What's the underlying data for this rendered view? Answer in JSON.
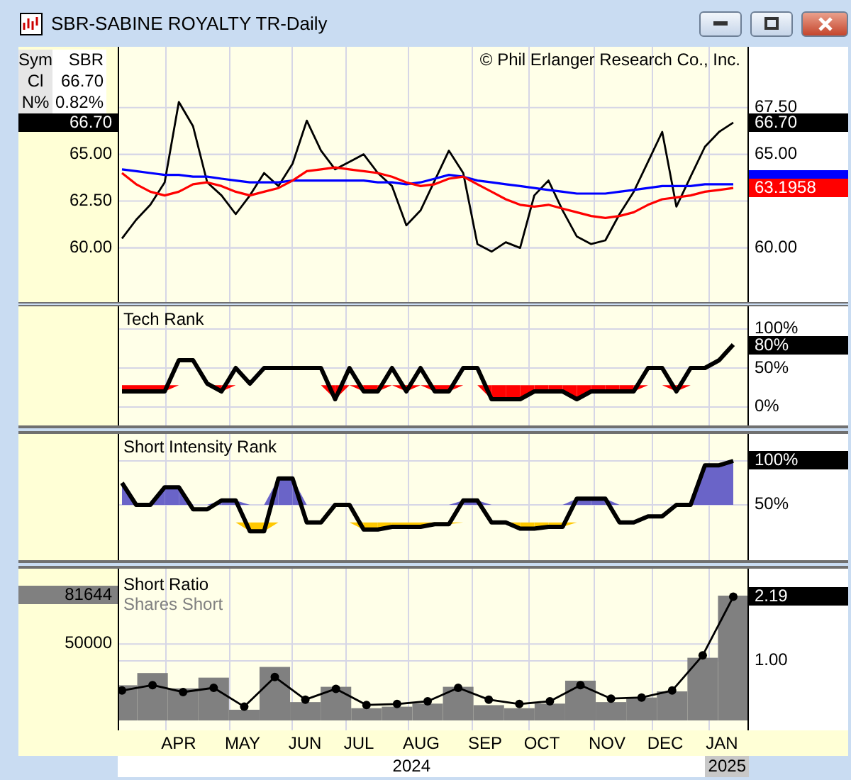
{
  "window": {
    "title": "SBR-SABINE ROYALTY TR-Daily"
  },
  "quote": {
    "rows": [
      {
        "label": "Sym",
        "value": "SBR"
      },
      {
        "label": "Cl",
        "value": "66.70"
      },
      {
        "label": "N%",
        "value": "0.82%"
      }
    ]
  },
  "copyright": "© Phil Erlanger Research Co., Inc.",
  "panels": [
    {
      "kind": "price",
      "left_ticks": [
        "65.00",
        "62.50",
        "60.00"
      ],
      "left_tags": [
        {
          "label": "66.70",
          "color": "#000000"
        }
      ],
      "right_tags": [
        {
          "label": "66.70",
          "color": "#000000"
        },
        {
          "label": "63.1958",
          "color": "#ff0000"
        }
      ],
      "chart_data": {
        "type": "line",
        "grid": true,
        "ylim": [
          57.1,
          70.75
        ],
        "yticks": [
          {
            "value": 67.5,
            "label": "67.50"
          },
          {
            "value": 65,
            "label": "65.00"
          },
          {
            "value": 60,
            "label": "60.00"
          }
        ],
        "series": [
          {
            "color": "#000000",
            "values": [
              60.5,
              61.5,
              62.3,
              63.5,
              67.8,
              66.5,
              63.5,
              62.8,
              61.8,
              62.8,
              64,
              63.3,
              64.5,
              66.8,
              65.2,
              64.2,
              64.6,
              65,
              64,
              63.3,
              61.2,
              62,
              63.6,
              65.2,
              64,
              60.2,
              59.8,
              60.3,
              60,
              62.8,
              63.6,
              62,
              60.6,
              60.2,
              60.4,
              61.8,
              63,
              64.6,
              66.2,
              62.2,
              63.8,
              65.4,
              66.2,
              66.7
            ]
          },
          {
            "color": "#0000ff",
            "values": [
              64.2,
              64.1,
              64,
              63.9,
              63.9,
              63.8,
              63.8,
              63.7,
              63.6,
              63.5,
              63.5,
              63.5,
              63.6,
              63.6,
              63.6,
              63.6,
              63.6,
              63.6,
              63.5,
              63.5,
              63.4,
              63.5,
              63.7,
              63.9,
              63.8,
              63.6,
              63.5,
              63.4,
              63.3,
              63.2,
              63.1,
              63,
              62.9,
              62.9,
              62.9,
              63,
              63.1,
              63.2,
              63.3,
              63.3,
              63.3,
              63.4,
              63.4,
              63.4
            ]
          },
          {
            "color": "#ff0000",
            "values": [
              64,
              63.4,
              63,
              62.8,
              63,
              63.4,
              63.5,
              63.3,
              63,
              62.8,
              63,
              63.2,
              63.6,
              64.1,
              64.2,
              64.3,
              64.2,
              64.1,
              64,
              63.8,
              63.5,
              63.3,
              63.4,
              63.7,
              63.8,
              63.4,
              63,
              62.6,
              62.3,
              62.2,
              62.3,
              62.1,
              61.9,
              61.7,
              61.6,
              61.7,
              61.9,
              62.3,
              62.6,
              62.7,
              62.8,
              63,
              63.1,
              63.2
            ]
          }
        ]
      }
    },
    {
      "kind": "rank_low",
      "right_tags": [
        {
          "label": "80%",
          "color": "#000000"
        }
      ],
      "chart_data": {
        "type": "line",
        "grid": true,
        "title": "Tech Rank",
        "ylim": [
          -23.6,
          129.1
        ],
        "yticks": [
          {
            "value": 100,
            "label": "100%"
          },
          {
            "value": 50,
            "label": "50%"
          },
          {
            "value": 0,
            "label": "0%"
          }
        ],
        "series": [
          {
            "color": "#000000",
            "values": [
              20,
              20,
              20,
              20,
              60,
              60,
              30,
              20,
              50,
              30,
              50,
              50,
              50,
              50,
              50,
              10,
              50,
              20,
              20,
              50,
              20,
              50,
              20,
              20,
              50,
              50,
              10,
              10,
              10,
              20,
              20,
              20,
              10,
              20,
              20,
              20,
              20,
              50,
              50,
              20,
              50,
              50,
              60,
              80
            ]
          }
        ]
      }
    },
    {
      "kind": "rank_split",
      "right_tick_tagged": [
        true,
        false
      ],
      "chart_data": {
        "type": "line",
        "grid": true,
        "title": "Short Intensity Rank",
        "ylim": [
          -12.9,
          130.6
        ],
        "yticks": [
          {
            "value": 100,
            "label": "100%"
          },
          {
            "value": 50,
            "label": "50%"
          }
        ],
        "series": [
          {
            "color": "#000000",
            "values": [
              75,
              50,
              50,
              70,
              70,
              45,
              45,
              55,
              55,
              20,
              20,
              80,
              80,
              30,
              30,
              50,
              50,
              22,
              22,
              25,
              25,
              25,
              28,
              28,
              55,
              55,
              30,
              30,
              23,
              23,
              25,
              25,
              57,
              57,
              57,
              30,
              30,
              37,
              37,
              50,
              50,
              95,
              95,
              100
            ]
          }
        ]
      }
    },
    {
      "kind": "ratio",
      "right_tick_tagged": [
        true,
        false
      ],
      "left_tick_tagged": [
        true,
        false
      ],
      "layers": [
        {
          "chart_data": {
            "type": "line",
            "grid": true,
            "ylim": [
              -0.29,
              2.71
            ],
            "categories": [
              null,
              null,
              null,
              null,
              null,
              null,
              null,
              null,
              null,
              null,
              null,
              null,
              null,
              null,
              null,
              null,
              null,
              null,
              null,
              null,
              null
            ],
            "yticks": [
              {
                "value": 2.19,
                "label": "2.19"
              },
              {
                "value": 1,
                "label": "1.00"
              }
            ],
            "series": [
              {
                "name": "Short Ratio",
                "color": "#000000",
                "marker": "circle",
                "values": [
                  0.45,
                  0.55,
                  0.42,
                  0.5,
                  0.15,
                  0.7,
                  0.28,
                  0.48,
                  0.18,
                  0.2,
                  0.25,
                  0.5,
                  0.28,
                  0.2,
                  0.25,
                  0.55,
                  0.3,
                  0.32,
                  0.45,
                  1.1,
                  2.19
                ]
              }
            ]
          }
        },
        {
          "chart_data": {
            "type": "bar",
            "grid": true,
            "ylim": [
              -6494,
              99263
            ],
            "categories": [
              null,
              null,
              null,
              null,
              null,
              null,
              null,
              null,
              null,
              null,
              null,
              null,
              null,
              null,
              null,
              null,
              null,
              null,
              null,
              null,
              null
            ],
            "yticks": [
              {
                "value": 81644,
                "label": "81644"
              },
              {
                "value": 50000,
                "label": "50000"
              }
            ],
            "series": [
              {
                "name": "Shares Short",
                "color": "#808080",
                "values": [
                  23000,
                  31000,
                  21000,
                  28000,
                  7000,
                  35000,
                  12000,
                  22000,
                  8000,
                  9000,
                  11000,
                  22000,
                  10000,
                  8000,
                  11000,
                  26000,
                  12000,
                  15000,
                  19000,
                  41000,
                  81644
                ]
              }
            ]
          }
        }
      ]
    }
  ],
  "x_axis": {
    "months": [
      "APR",
      "MAY",
      "JUN",
      "JUL",
      "AUG",
      "SEP",
      "OCT",
      "NOV",
      "DEC",
      "JAN"
    ],
    "years": [
      {
        "label": "2024",
        "highlighted": false
      },
      {
        "label": "2025",
        "highlighted": true
      }
    ]
  }
}
